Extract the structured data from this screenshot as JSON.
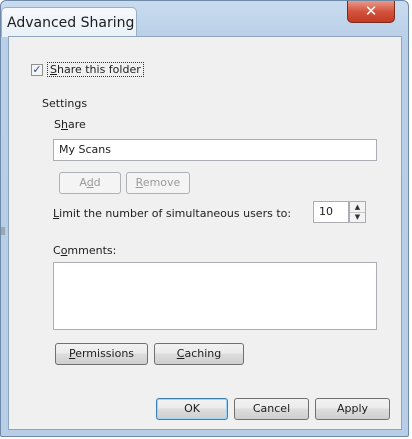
{
  "window": {
    "title": "Advanced Sharing",
    "close_glyph": "✕"
  },
  "share_folder": {
    "checked": true,
    "check_glyph": "✓",
    "label_accel": "S",
    "label_rest": "hare this folder"
  },
  "settings": {
    "section_label": "Settings",
    "share_name_label_pre": "S",
    "share_name_label_accel": "h",
    "share_name_label_post": "are",
    "share_name_value": "My Scans",
    "add_button_accel": "d",
    "add_button_pre": "A",
    "add_button_post": "d",
    "remove_button_accel": "R",
    "remove_button_rest": "emove",
    "limit_label_accel": "L",
    "limit_label_rest": "imit the number of simultaneous users to:",
    "limit_value": "10",
    "spin_up_glyph": "▲",
    "spin_down_glyph": "▼",
    "comments_label_pre": "C",
    "comments_label_accel": "o",
    "comments_label_post": "mments:",
    "comments_value": "",
    "permissions_accel": "P",
    "permissions_rest": "ermissions",
    "caching_accel": "C",
    "caching_rest": "aching"
  },
  "footer": {
    "ok_label": "OK",
    "cancel_label": "Cancel",
    "apply_label": "Apply"
  },
  "colors": {
    "frame": "#b9cfe8",
    "close": "#c43a22",
    "client": "#f0f0f0"
  }
}
